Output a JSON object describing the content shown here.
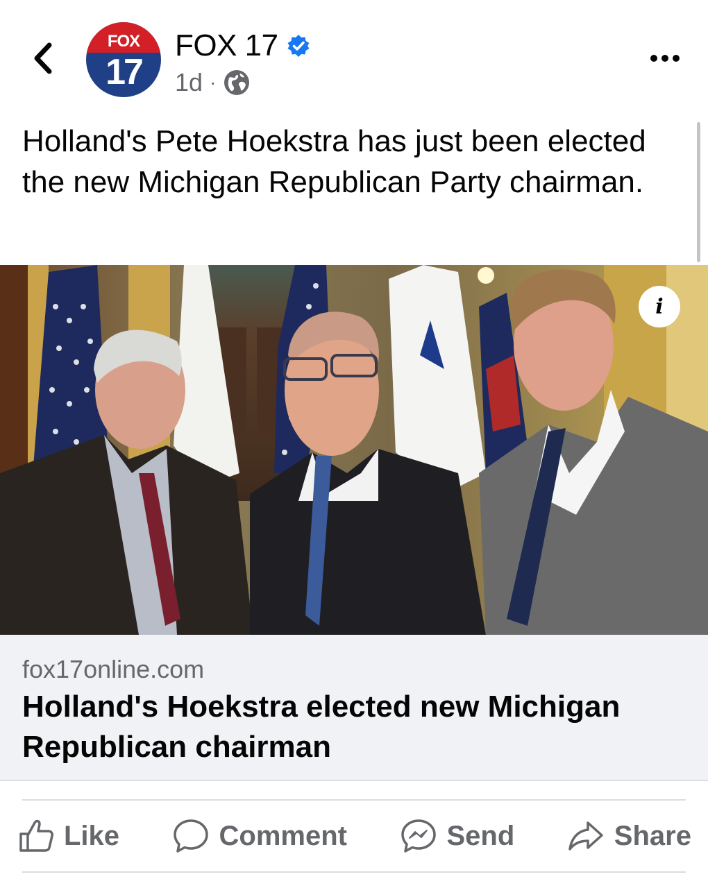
{
  "header": {
    "page_name": "FOX 17",
    "avatar_top": "FOX",
    "avatar_number": "17",
    "time": "1d",
    "separator": "·",
    "audience_icon": "globe-icon",
    "verified_icon": "verified-badge-icon"
  },
  "post": {
    "text": "Holland's Pete Hoekstra has just been elected the new Michigan Republican Party chairman."
  },
  "link_preview": {
    "domain": "fox17online.com",
    "title": "Holland's Hoekstra elected new Michigan Republican chairman"
  },
  "actions": [
    {
      "label": "Like",
      "icon": "thumbs-up-icon"
    },
    {
      "label": "Comment",
      "icon": "comment-bubble-icon"
    },
    {
      "label": "Send",
      "icon": "messenger-icon"
    },
    {
      "label": "Share",
      "icon": "share-arrow-icon"
    }
  ],
  "colors": {
    "brand_red": "#d32027",
    "brand_blue": "#1f3f86",
    "verified_blue": "#1877f2",
    "secondary_text": "#65676b",
    "link_bg": "#f0f2f5"
  }
}
